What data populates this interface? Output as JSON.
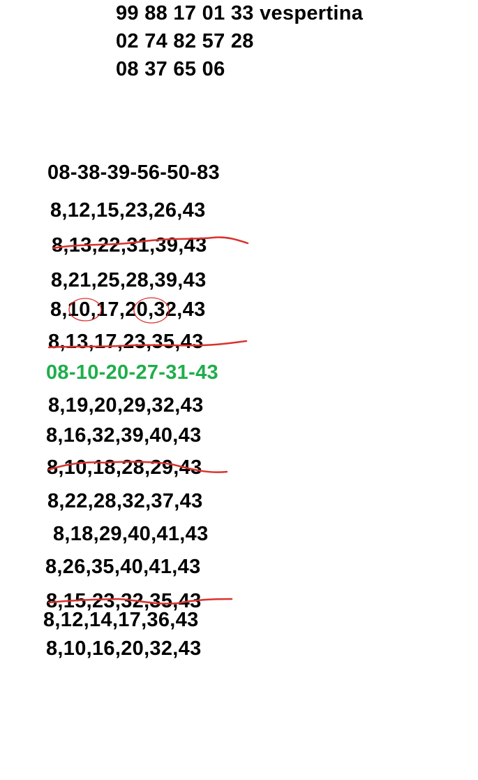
{
  "header_lines": [
    "99 88 17 01 33 vespertina",
    "02 74 82 57 28",
    "08 37 65 06"
  ],
  "combinations": [
    "08-38-39-56-50-83",
    "8,12,15,23,26,43",
    "8,13,22,31,39,43",
    "8,21,25,28,39,43",
    "8,10,17,20,32,43",
    "8,13,17,23,35,43",
    "08-10-20-27-31-43",
    "8,19,20,29,32,43",
    "8,16,32,39,40,43",
    "8,10,18,28,29,43",
    "8,22,28,32,37,43",
    "8,18,29,40,41,43",
    "8,26,35,40,41,43",
    "8,15,23,32,35,43",
    "8,12,14,17,36,43",
    "8,10,16,20,32,43"
  ],
  "colors": {
    "text": "#000000",
    "highlight": "#1fae4b",
    "strike": "#d9322e",
    "circle": "#d9322e"
  }
}
